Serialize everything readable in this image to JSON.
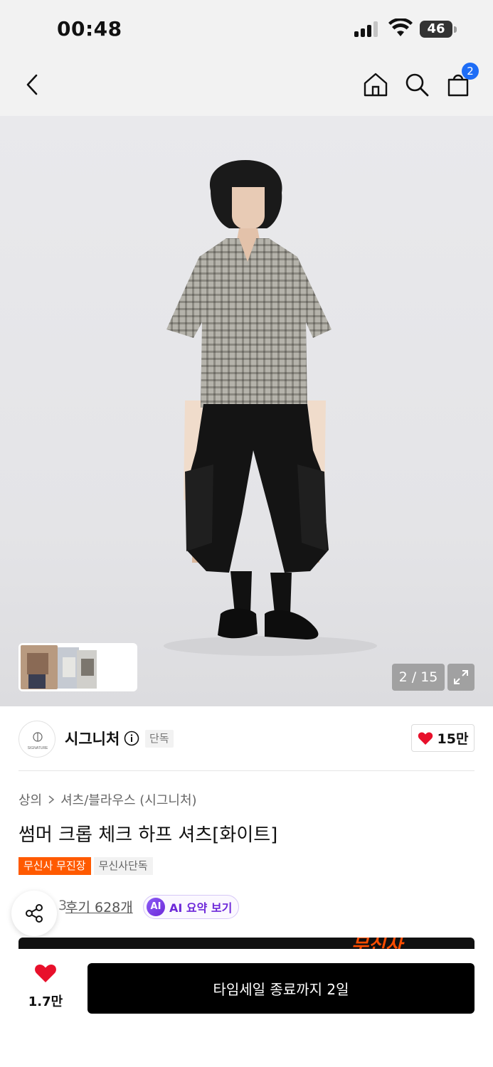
{
  "status_bar": {
    "time": "00:48",
    "battery": "46"
  },
  "header": {
    "cart_count": "2"
  },
  "gallery": {
    "page_indicator": "2 / 15"
  },
  "brand": {
    "name": "시그니처",
    "logo_text": "SIGNATURE",
    "exclusive_tag": "단독",
    "like_count": "15만"
  },
  "product": {
    "breadcrumb": [
      "상의",
      "셔츠/블라우스 (시그니처)"
    ],
    "title": "썸머 크롭 체크 하프 셔츠[화이트]",
    "tags": [
      "무신사 무진장",
      "무신사단독"
    ],
    "rating_partial": "3",
    "review_link": "후기 628개",
    "ai_badge": "AI",
    "ai_summary_label": "AI 요약 보기"
  },
  "promo": {
    "text": "무신사"
  },
  "bottom_bar": {
    "like_count": "1.7만",
    "purchase_label": "타임세일 종료까지 2일"
  },
  "colors": {
    "accent_orange": "#ff5a00",
    "like_red": "#e8102b",
    "cart_badge": "#1e6df6",
    "ai_purple": "#6d28d9"
  },
  "icons": [
    "back-icon",
    "home-icon",
    "search-icon",
    "cart-icon",
    "expand-icon",
    "info-icon",
    "heart-icon",
    "chevron-right-icon",
    "star-icon",
    "share-icon"
  ]
}
